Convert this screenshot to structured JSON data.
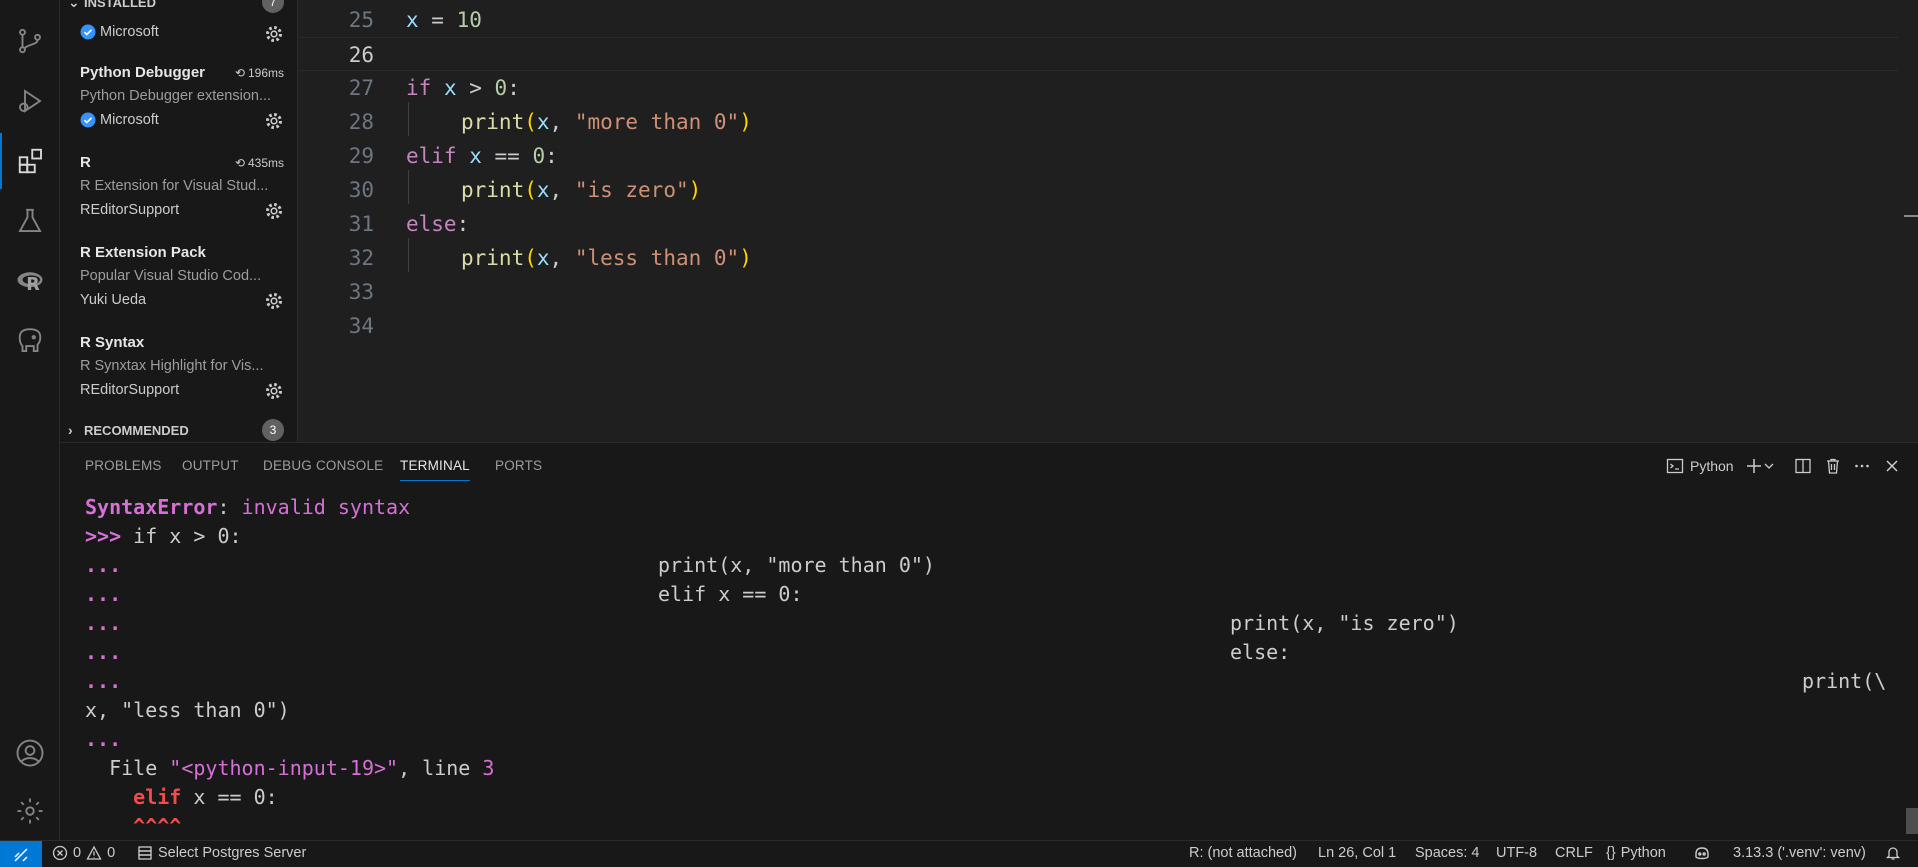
{
  "sidebar": {
    "installed_label": "INSTALLED",
    "installed_count": "7",
    "partial_publisher": "Microsoft",
    "extensions": [
      {
        "name": "Python Debugger",
        "time": "196ms",
        "desc": "Python Debugger extension...",
        "publisher": "Microsoft",
        "verified": true
      },
      {
        "name": "R",
        "time": "435ms",
        "desc": "R Extension for Visual Stud...",
        "publisher": "REditorSupport",
        "verified": false
      },
      {
        "name": "R Extension Pack",
        "time": "",
        "desc": "Popular Visual Studio Cod...",
        "publisher": "Yuki Ueda",
        "verified": false
      },
      {
        "name": "R Syntax",
        "time": "",
        "desc": "R Synxtax Highlight for Vis...",
        "publisher": "REditorSupport",
        "verified": false
      }
    ],
    "recommended_label": "RECOMMENDED",
    "recommended_count": "3"
  },
  "editor": {
    "line_numbers": [
      "25",
      "26",
      "27",
      "28",
      "29",
      "30",
      "31",
      "32",
      "33",
      "34"
    ],
    "code": {
      "l25_var": "x",
      "l25_op": " = ",
      "l25_num": "10",
      "l27_kw": "if",
      "l27_var": " x",
      "l27_op": " > ",
      "l27_num": "0",
      "l27_colon": ":",
      "l28_fn": "print",
      "l28_open": "(",
      "l28_var": "x",
      "l28_comma": ", ",
      "l28_str": "\"more than 0\"",
      "l28_close": ")",
      "l29_kw": "elif",
      "l29_var": " x",
      "l29_op": " == ",
      "l29_num": "0",
      "l29_colon": ":",
      "l30_fn": "print",
      "l30_open": "(",
      "l30_var": "x",
      "l30_comma": ", ",
      "l30_str": "\"is zero\"",
      "l30_close": ")",
      "l31_kw": "else",
      "l31_colon": ":",
      "l32_fn": "print",
      "l32_open": "(",
      "l32_var": "x",
      "l32_comma": ", ",
      "l32_str": "\"less than 0\"",
      "l32_close": ")"
    }
  },
  "panel": {
    "tabs": [
      "PROBLEMS",
      "OUTPUT",
      "DEBUG CONSOLE",
      "TERMINAL",
      "PORTS"
    ],
    "terminal_profile": "Python"
  },
  "terminal": {
    "error_name": "SyntaxError",
    "error_colon": ": ",
    "error_msg": "invalid syntax",
    "prompt": ">>>",
    "cmd1": " if x > 0:",
    "cont": "...",
    "t2": "print(x, \"more than 0\")",
    "t3": "elif x == 0:",
    "t4": "print(x, \"is zero\")",
    "t5": "else:",
    "t6": "print(\\",
    "t7": "x, \"less than 0\")",
    "file_prefix": "  File ",
    "file_name": "\"<python-input-19>\"",
    "line_prefix": ", line ",
    "line_no": "3",
    "err_kw": "    elif",
    "err_rest": " x == 0:",
    "carets": "    ^^^^"
  },
  "status": {
    "errors": "0",
    "warnings": "0",
    "postgres": "Select Postgres Server",
    "r_status": "R: (not attached)",
    "position": "Ln 26, Col 1",
    "spaces": "Spaces: 4",
    "encoding": "UTF-8",
    "eol": "CRLF",
    "language": "Python",
    "interpreter": "3.13.3 ('.venv': venv)"
  },
  "colors": {
    "accent": "#0078d4",
    "keyword": "#c586c0",
    "string": "#ce9178",
    "function": "#dcdcaa",
    "variable": "#9cdcfe",
    "number": "#b5cea8"
  }
}
